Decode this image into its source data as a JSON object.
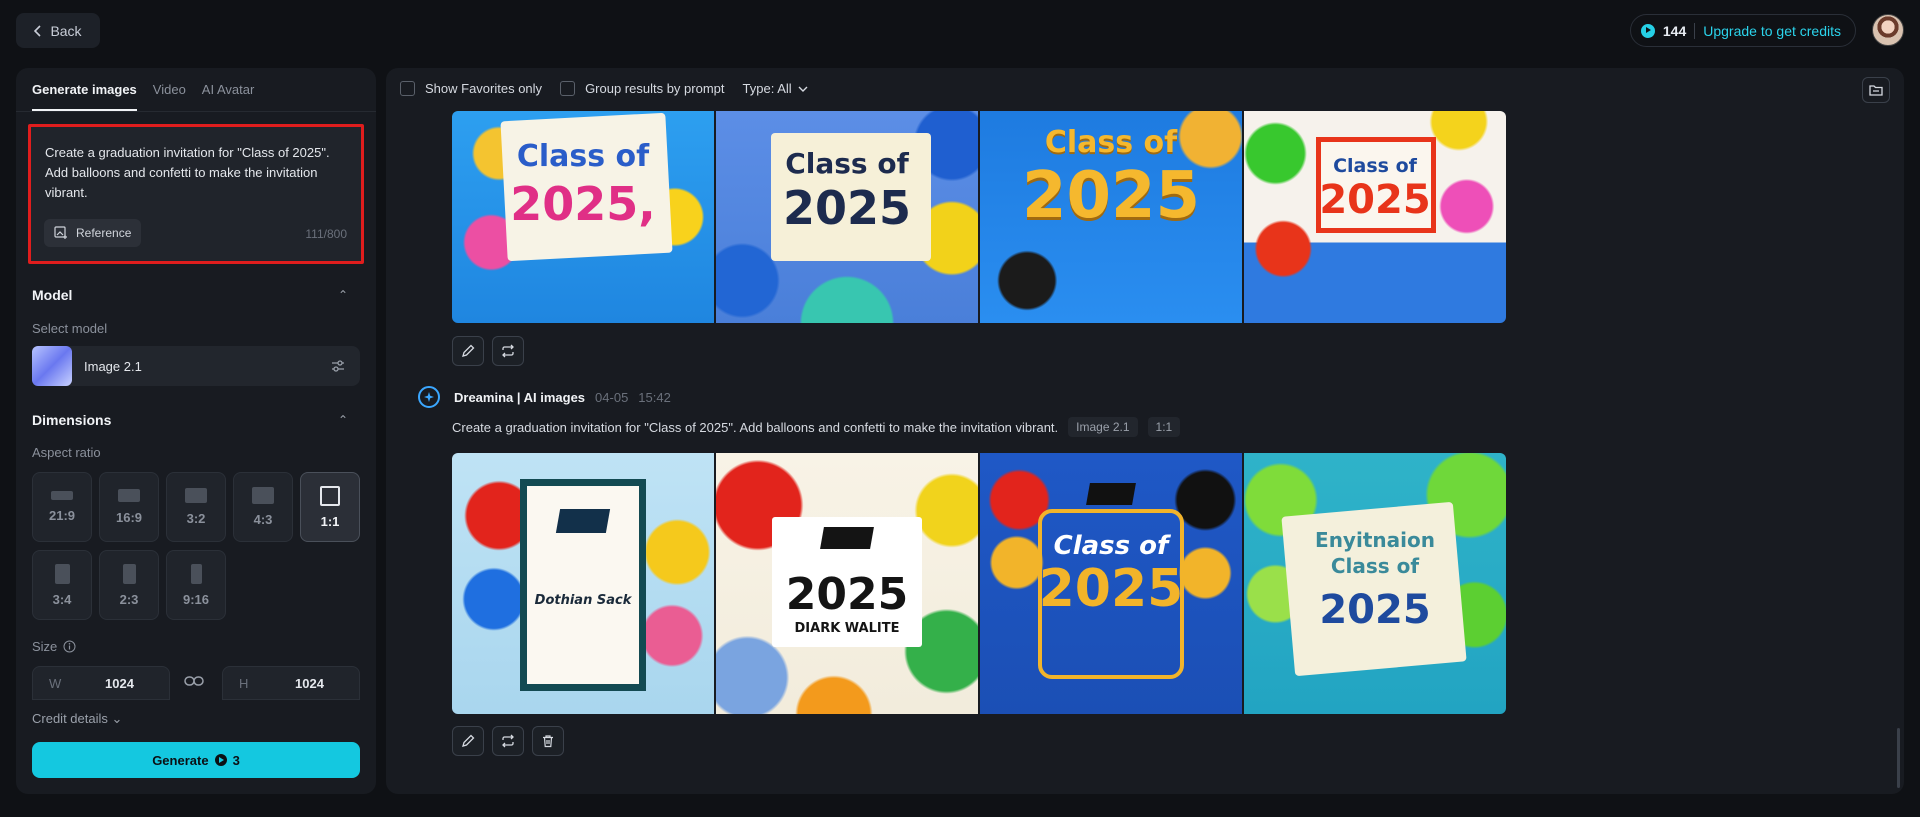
{
  "topbar": {
    "back_label": "Back",
    "credits": "144",
    "upgrade_label": "Upgrade to get credits"
  },
  "left": {
    "tabs": [
      {
        "label": "Generate images",
        "active": true
      },
      {
        "label": "Video",
        "active": false
      },
      {
        "label": "AI Avatar",
        "active": false
      }
    ],
    "prompt": "Create a graduation invitation for \"Class of 2025\".  Add balloons and confetti to make the invitation vibrant.",
    "reference_label": "Reference",
    "char_count": "111/800",
    "model_title": "Model",
    "select_model_label": "Select model",
    "model_name": "Image 2.1",
    "dimensions_title": "Dimensions",
    "aspect_ratio_label": "Aspect ratio",
    "ratios": [
      "21:9",
      "16:9",
      "3:2",
      "4:3",
      "1:1",
      "3:4",
      "2:3",
      "9:16"
    ],
    "selected_ratio": "1:1",
    "size_label": "Size",
    "width_key": "W",
    "width_value": "1024",
    "height_key": "H",
    "height_value": "1024",
    "credit_details_label": "Credit details",
    "generate_label": "Generate",
    "generate_cost": "3"
  },
  "main": {
    "show_favorites_label": "Show Favorites only",
    "group_by_prompt_label": "Group results by prompt",
    "type_filter_label": "Type: All",
    "row1_images": [
      {
        "title": "Class of",
        "year": "2025,"
      },
      {
        "title": "Class of",
        "year": "2025"
      },
      {
        "title": "Class of",
        "year": "2025"
      },
      {
        "title": "Class of",
        "year": "2025"
      }
    ],
    "entry": {
      "author": "Dreamina | AI images",
      "date": "04-05",
      "time": "15:42",
      "prompt": "Create a graduation invitation for \"Class of 2025\". Add balloons and confetti to make the invitation vibrant.",
      "model_tag": "Image 2.1",
      "ratio_tag": "1:1"
    },
    "row2_images": [
      {
        "title": "Dothian Sack",
        "year": ""
      },
      {
        "title": "DIARK WALITE",
        "year": "2025"
      },
      {
        "title": "Class of",
        "year": "2025"
      },
      {
        "title": "Enyitnaion Class of",
        "year": "2025"
      }
    ]
  },
  "colors": {
    "accent": "#14c8e0",
    "highlight_border": "#e01d1d",
    "panel": "#181b21",
    "background": "#0f1115"
  }
}
